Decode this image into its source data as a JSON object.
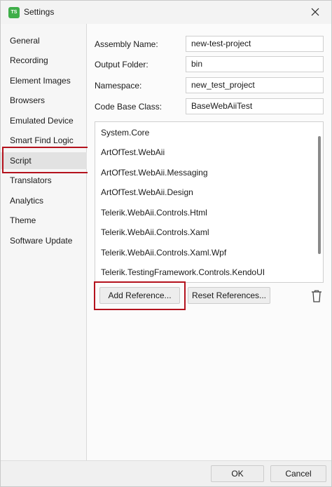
{
  "window": {
    "title": "Settings",
    "app_icon_text": "TS"
  },
  "sidebar": {
    "items": [
      {
        "label": "General"
      },
      {
        "label": "Recording"
      },
      {
        "label": "Element Images"
      },
      {
        "label": "Browsers"
      },
      {
        "label": "Emulated Device"
      },
      {
        "label": "Smart Find Logic"
      },
      {
        "label": "Script",
        "selected": true
      },
      {
        "label": "Translators"
      },
      {
        "label": "Analytics"
      },
      {
        "label": "Theme"
      },
      {
        "label": "Software Update"
      }
    ]
  },
  "form": {
    "assembly_name": {
      "label": "Assembly Name:",
      "value": "new-test-project"
    },
    "output_folder": {
      "label": "Output Folder:",
      "value": "bin"
    },
    "namespace": {
      "label": "Namespace:",
      "value": "new_test_project"
    },
    "code_base_class": {
      "label": "Code Base Class:",
      "value": "BaseWebAiiTest"
    }
  },
  "references": [
    "System.Core",
    "ArtOfTest.WebAii",
    "ArtOfTest.WebAii.Messaging",
    "ArtOfTest.WebAii.Design",
    "Telerik.WebAii.Controls.Html",
    "Telerik.WebAii.Controls.Xaml",
    "Telerik.WebAii.Controls.Xaml.Wpf",
    "Telerik.TestingFramework.Controls.KendoUI"
  ],
  "buttons": {
    "add_reference": "Add Reference...",
    "reset_references": "Reset References...",
    "ok": "OK",
    "cancel": "Cancel"
  },
  "icons": {
    "close": "close-icon",
    "delete": "trash-icon"
  },
  "colors": {
    "highlight": "#b4121d",
    "app_icon": "#3fae49"
  }
}
